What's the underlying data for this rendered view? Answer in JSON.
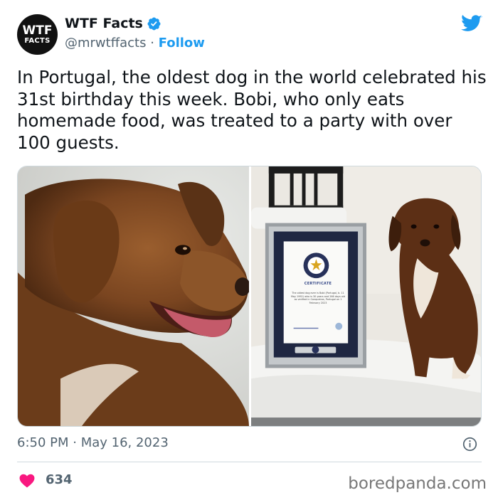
{
  "account": {
    "avatar_line1": "WTF",
    "avatar_line2": "FACTS",
    "display_name": "WTF Facts",
    "handle": "@mrwtffacts",
    "separator": " · ",
    "follow_label": "Follow"
  },
  "tweet": {
    "text": "In Portugal, the oldest dog in the world celebrated his 31st birthday this week. Bobi, who only eats homemade food, was treated to a party with over 100 guests.",
    "timestamp": "6:50 PM · May 16, 2023",
    "likes": "634"
  },
  "certificate": {
    "title": "CERTIFICATE",
    "body": "The oldest dog ever is Bobi (Portugal, b. 11 May 1992) who is 30 years and 266 days old as verified in Conqueiros, Portugal on 1 February 2023"
  },
  "watermark": "boredpanda.com",
  "colors": {
    "accent_blue": "#1d9bf0",
    "heart_red": "#f91880",
    "secondary_text": "#536471"
  },
  "icons": {
    "verified": "verified-badge-icon",
    "platform": "twitter-bird-icon",
    "info": "info-icon",
    "like": "heart-icon"
  }
}
